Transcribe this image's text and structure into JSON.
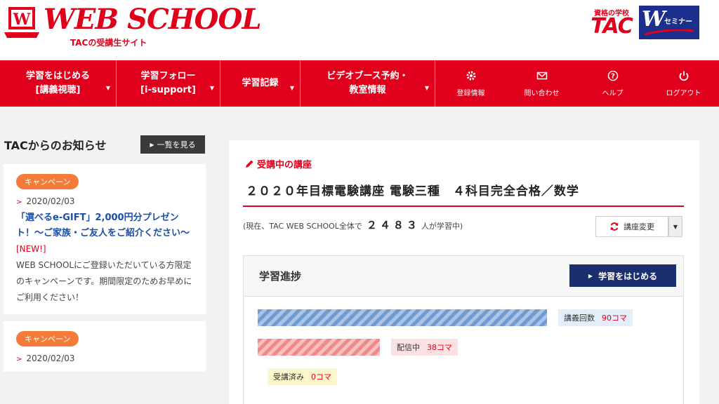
{
  "header": {
    "logo_text": "WEB SCHOOL",
    "logo_subtitle": "TACの受講生サイト",
    "tac_tagline": "資格の学校",
    "tac_logo": "TAC",
    "w_seminar": "セミナー"
  },
  "nav": {
    "items": [
      {
        "line1": "学習をはじめる",
        "line2": "[講義視聴]"
      },
      {
        "line1": "学習フォロー",
        "line2": "[i-support]"
      },
      {
        "line1": "学習記録",
        "line2": ""
      },
      {
        "line1": "ビデオブース予約・",
        "line2": "教室情報"
      }
    ],
    "icons": [
      {
        "label": "登録情報",
        "icon": "gear-icon"
      },
      {
        "label": "問い合わせ",
        "icon": "envelope-icon"
      },
      {
        "label": "ヘルプ",
        "icon": "help-icon"
      },
      {
        "label": "ログアウト",
        "icon": "power-icon"
      }
    ]
  },
  "news": {
    "title": "TACからのお知らせ",
    "all_button": "一覧を見る",
    "cards": [
      {
        "badge": "キャンペーン",
        "date": "2020/02/03",
        "headline": "「選べるe-GIFT」2,000円分プレゼント！～ご家族・ご友人をご紹介ください～",
        "new_mark": "[NEW!]",
        "body": "WEB SCHOOLにご登録いただいている方限定のキャンペーンです。期間限定のためお早めにご利用ください！"
      },
      {
        "badge": "キャンペーン",
        "date": "2020/02/03",
        "headline": "",
        "new_mark": "",
        "body": ""
      }
    ]
  },
  "course": {
    "label": "受講中の講座",
    "title": "２０２０年目標電験講座 電験三種　４科目完全合格／数学",
    "learners_prefix": "(現在、TAC WEB SCHOOL全体で",
    "learners_count": "２４８３",
    "learners_suffix": "人が学習中)",
    "change_button": "講座変更"
  },
  "progress": {
    "title": "学習進捗",
    "start_button": "学習をはじめる",
    "stats": [
      {
        "label": "講義回数",
        "value": "90コマ",
        "count": 90
      },
      {
        "label": "配信中",
        "value": "38コマ",
        "count": 38
      },
      {
        "label": "受講済み",
        "value": "0コマ",
        "count": 0
      }
    ],
    "colors": {
      "total": "#6f9bd0",
      "delivering": "#ee8a8a",
      "done": "#fdf5cc"
    }
  }
}
